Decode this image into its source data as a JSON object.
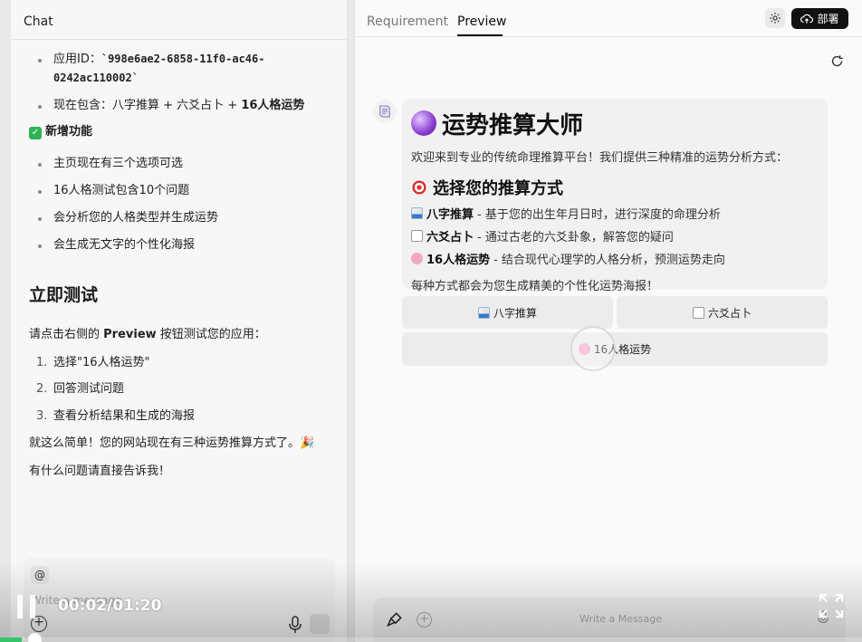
{
  "chat": {
    "title": "Chat",
    "app_id_label": "应用ID：",
    "app_id_value": "`998e6ae2-6858-11f0-ac46-0242ac110002`",
    "contains_text": "现在包含：八字推算 + 六爻占卜 + ",
    "contains_bold": "16人格运势",
    "new_features_title": "新增功能",
    "features": [
      "主页现在有三个选项可选",
      "16人格测试包含10个问题",
      "会分析您的人格类型并生成运势",
      "会生成无文字的个性化海报"
    ],
    "test_heading": "立即测试",
    "instruction_prefix": "请点击右侧的 ",
    "instruction_bold": "Preview",
    "instruction_suffix": " 按钮测试您的应用：",
    "steps": [
      {
        "num": "1.",
        "text": "选择\"16人格运势\""
      },
      {
        "num": "2.",
        "text": "回答测试问题"
      },
      {
        "num": "3.",
        "text": "查看分析结果和生成的海报"
      }
    ],
    "done_text": "就这么简单！您的网站现在有三种运势推算方式了。🎉",
    "ask_text": "有什么问题请直接告诉我！",
    "composer": {
      "at_label": "@",
      "placeholder": "Write a message"
    }
  },
  "preview": {
    "tabs": [
      "Requirement",
      "Preview"
    ],
    "deploy_label": "部署",
    "card": {
      "title": "运势推算大师",
      "welcome": "欢迎来到专业的传统命理推算平台！我们提供三种精准的运势分析方式：",
      "choose_title": "选择您的推算方式",
      "options": [
        {
          "name": "八字推算",
          "desc": " - 基于您的出生年月日时，进行深度的命理分析",
          "icon": "chart-icon"
        },
        {
          "name": "六爻占卜",
          "desc": " - 通过古老的六爻卦象，解答您的疑问",
          "icon": "dice-icon"
        },
        {
          "name": "16人格运势",
          "desc": " - 结合现代心理学的人格分析，预测运势走向",
          "icon": "brain-icon"
        }
      ],
      "footer": "每种方式都会为您生成精美的个性化运势海报！"
    },
    "buttons": {
      "bazi": "八字推算",
      "liuyao": "六爻占卜",
      "mbti": "16人格运势"
    },
    "message_placeholder": "Write a Message"
  },
  "player": {
    "time": "00:02/01:20",
    "progress": 0.025,
    "progress_color": "#35c46a"
  }
}
